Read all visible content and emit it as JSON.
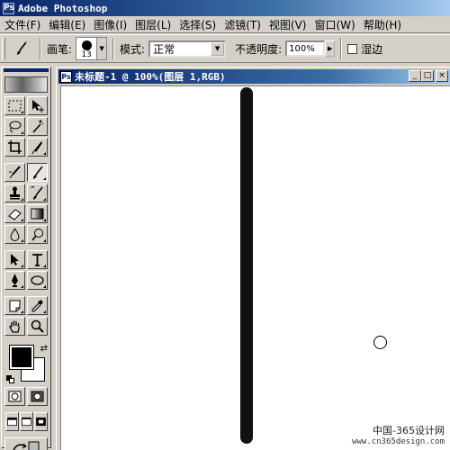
{
  "app": {
    "title": "Adobe Photoshop"
  },
  "menu": [
    "文件(F)",
    "编辑(E)",
    "图像(I)",
    "图层(L)",
    "选择(S)",
    "滤镜(T)",
    "视图(V)",
    "窗口(W)",
    "帮助(H)"
  ],
  "options": {
    "brush_label": "画笔:",
    "brush_size": "13",
    "mode_label": "模式:",
    "mode_value": "正常",
    "opacity_label": "不透明度:",
    "opacity_value": "100%",
    "wet_edges_label": "湿边",
    "wet_edges_checked": false
  },
  "toolbox": {
    "tools": [
      [
        "marquee-tool",
        "move-tool"
      ],
      [
        "lasso-tool",
        "magic-wand-tool"
      ],
      [
        "crop-tool",
        "slice-tool"
      ],
      [
        "airbrush-tool",
        "paintbrush-tool"
      ],
      [
        "clone-stamp-tool",
        "history-brush-tool"
      ],
      [
        "eraser-tool",
        "gradient-tool"
      ],
      [
        "blur-tool",
        "dodge-tool"
      ],
      [
        "path-selection-tool",
        "type-tool"
      ],
      [
        "pen-tool",
        "ellipse-tool"
      ],
      [
        "notes-tool",
        "eyedropper-tool"
      ],
      [
        "hand-tool",
        "zoom-tool"
      ]
    ],
    "active_tool": "paintbrush-tool",
    "foreground_color": "#000000",
    "background_color": "#ffffff"
  },
  "document": {
    "title": "未标题-1 @ 100%(图层 1,RGB)"
  },
  "watermark": {
    "line1": "中国-365设计网",
    "line2": "www.cn365design.com"
  },
  "colors": {
    "title_bar": "#0a246a",
    "stroke": "#111111",
    "canvas": "#ffffff"
  }
}
